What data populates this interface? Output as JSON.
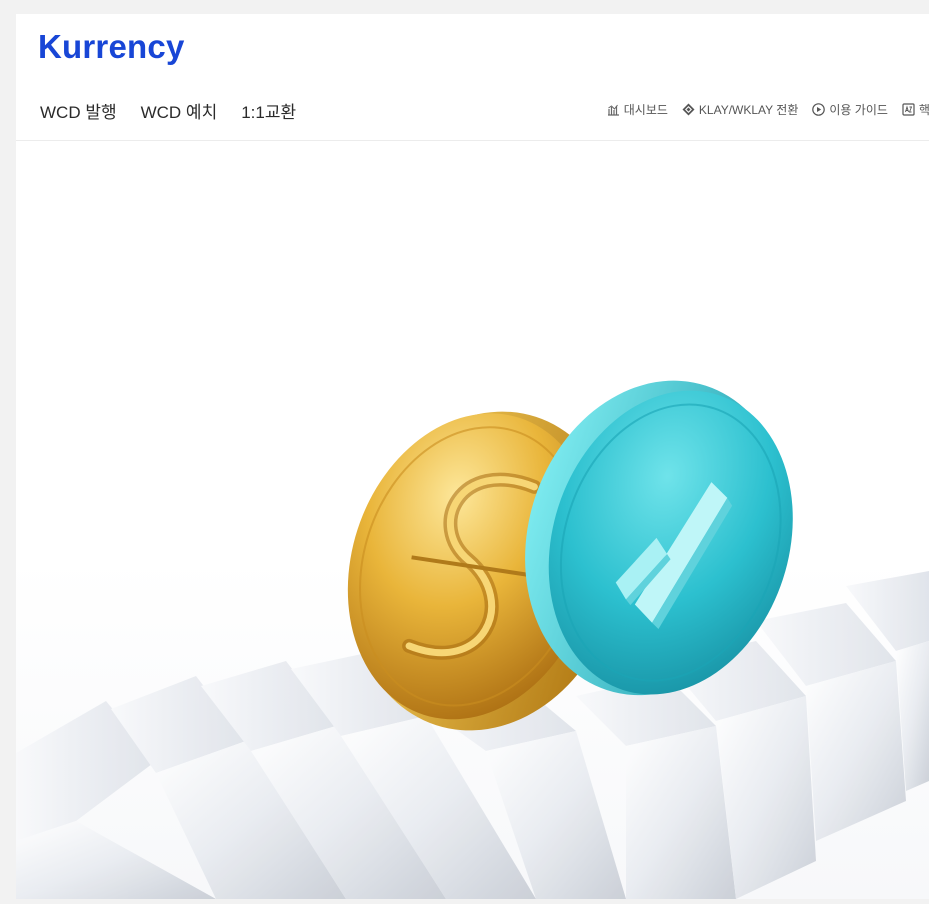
{
  "brand": {
    "name": "Kurrency",
    "color": "#1846d6"
  },
  "main_nav": [
    {
      "label": "WCD 발행"
    },
    {
      "label": "WCD 예치"
    },
    {
      "label": "1:1교환"
    }
  ],
  "util_nav": [
    {
      "label": "대시보드",
      "icon": "dashboard-icon"
    },
    {
      "label": "KLAY/WKLAY 전환",
      "icon": "klaytn-icon"
    },
    {
      "label": "이용 가이드",
      "icon": "play-circle-icon"
    },
    {
      "label": "핵심",
      "icon": "glossary-icon"
    }
  ],
  "hero": {
    "image": "gold-coin-and-teal-coin-on-glass-bars"
  },
  "colors": {
    "gold": "#e0a92a",
    "teal": "#2bbccc",
    "accent": "#1846d6"
  }
}
